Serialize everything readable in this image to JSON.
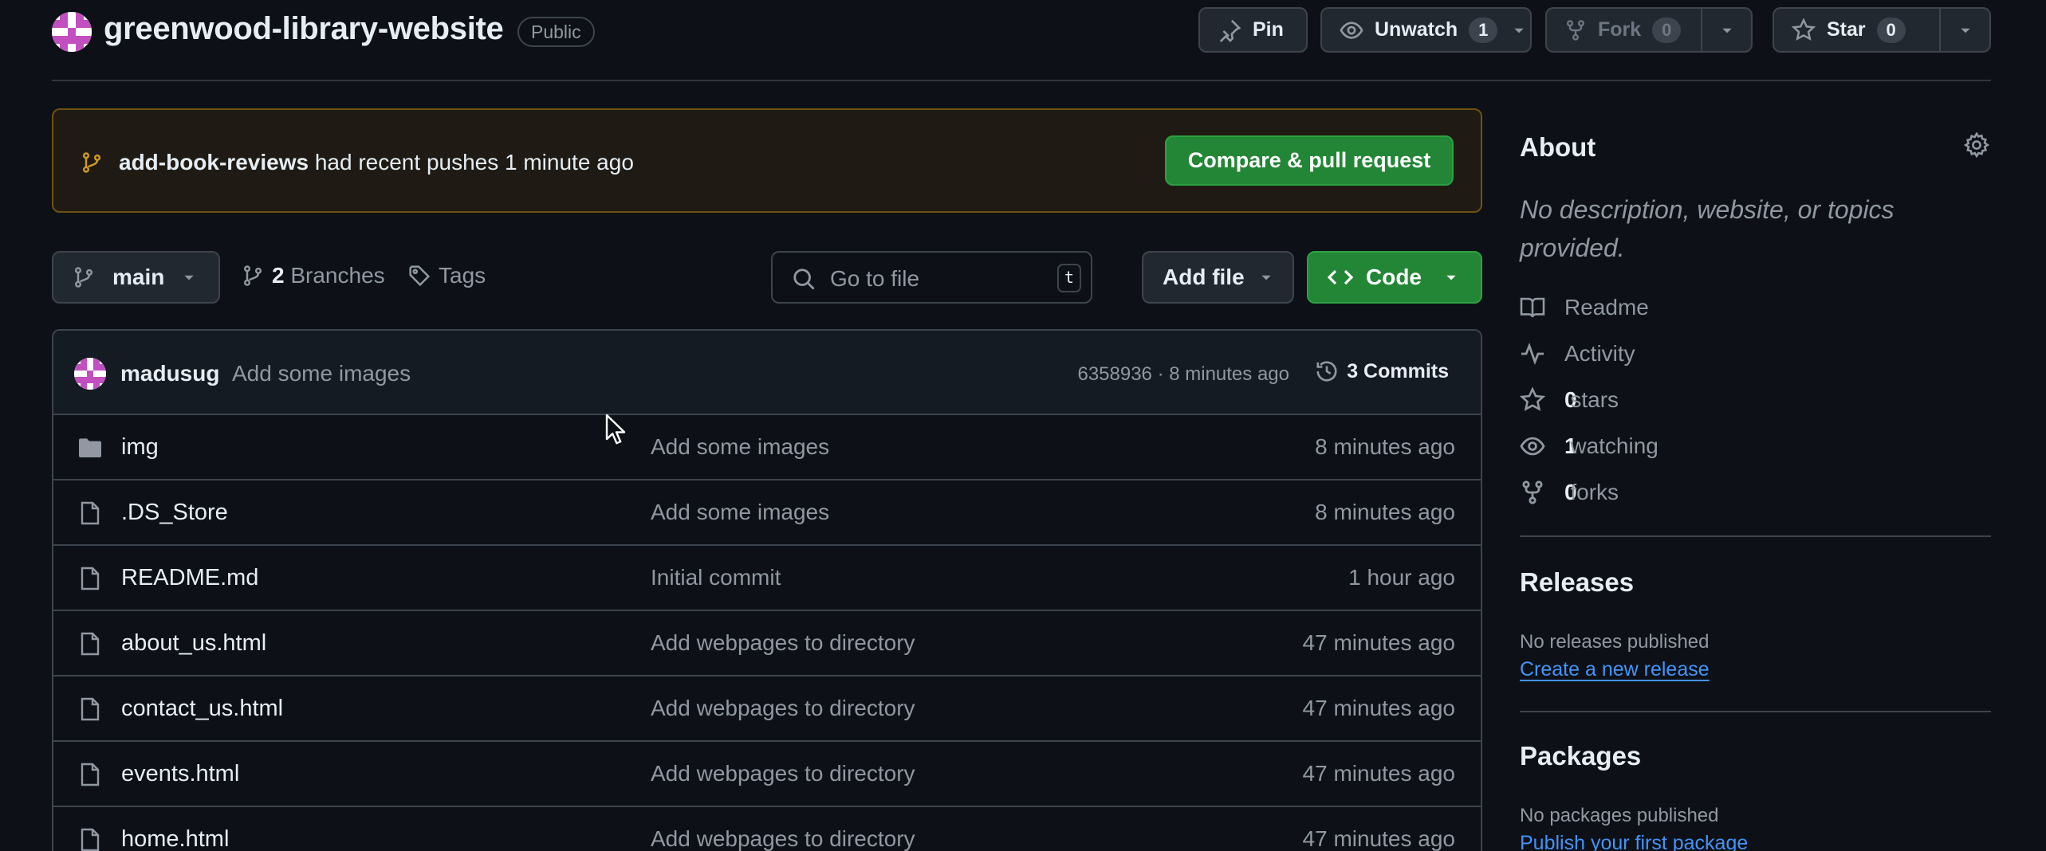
{
  "repo": {
    "name": "greenwood-library-website",
    "visibility": "Public"
  },
  "header_actions": {
    "pin_label": "Pin",
    "unwatch_label": "Unwatch",
    "watch_count": "1",
    "fork_label": "Fork",
    "fork_count": "0",
    "star_label": "Star",
    "star_count": "0"
  },
  "flash": {
    "branch": "add-book-reviews",
    "text": " had recent pushes 1 minute ago",
    "button": "Compare & pull request"
  },
  "toolbar": {
    "branch": "main",
    "branches_count": "2",
    "branches_label": "Branches",
    "tags_label": "Tags",
    "search_placeholder": "Go to file",
    "search_shortcut": "t",
    "add_file_label": "Add file",
    "code_label": "Code"
  },
  "latest_commit": {
    "author": "madusug",
    "message": "Add some images",
    "meta": "6358936 · 8 minutes ago",
    "commits_label": "3 Commits"
  },
  "files": [
    {
      "name": "img",
      "type": "folder",
      "message": "Add some images",
      "time": "8 minutes ago"
    },
    {
      "name": ".DS_Store",
      "type": "file",
      "message": "Add some images",
      "time": "8 minutes ago"
    },
    {
      "name": "README.md",
      "type": "file",
      "message": "Initial commit",
      "time": "1 hour ago"
    },
    {
      "name": "about_us.html",
      "type": "file",
      "message": "Add webpages to directory",
      "time": "47 minutes ago"
    },
    {
      "name": "contact_us.html",
      "type": "file",
      "message": "Add webpages to directory",
      "time": "47 minutes ago"
    },
    {
      "name": "events.html",
      "type": "file",
      "message": "Add webpages to directory",
      "time": "47 minutes ago"
    },
    {
      "name": "home.html",
      "type": "file",
      "message": "Add webpages to directory",
      "time": "47 minutes ago"
    }
  ],
  "about": {
    "title": "About",
    "description": "No description, website, or topics provided.",
    "readme": "Readme",
    "activity": "Activity",
    "stars_count": "0",
    "stars_label": "stars",
    "watching_count": "1",
    "watching_label": "watching",
    "forks_count": "0",
    "forks_label": "forks"
  },
  "releases": {
    "title": "Releases",
    "empty": "No releases published",
    "link": "Create a new release"
  },
  "packages": {
    "title": "Packages",
    "empty": "No packages published",
    "link": "Publish your first package"
  },
  "colors": {
    "background": "#0d1117",
    "border": "#3d444d",
    "accent_green": "#238636",
    "link_blue": "#4493f8",
    "flash_border": "#6e5214",
    "avatar_pink": "#c24fc0"
  }
}
